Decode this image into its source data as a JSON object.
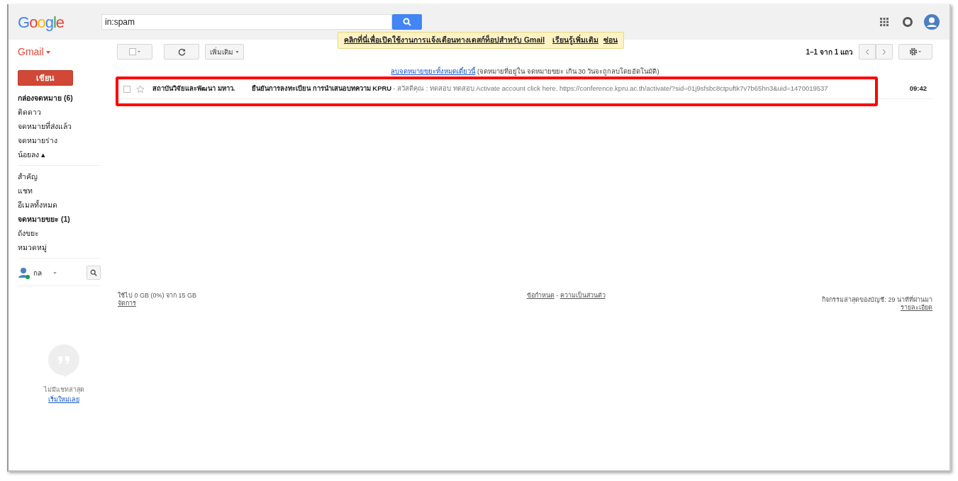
{
  "header": {
    "logo": "Google",
    "search": {
      "value": "in:spam"
    }
  },
  "notification": {
    "text": "คลิกที่นี่เพื่อเปิดใช้งานการแจ้งเตือนทางเดสก์ท็อปสำหรับ Gmail",
    "learn_more": "เรียนรู้เพิ่มเติม",
    "hide": "ซ่อน"
  },
  "app_label": "Gmail",
  "toolbar": {
    "more": "เพิ่มเติม",
    "pagination": "1–1 จาก 1 แถว"
  },
  "compose": "เขียน",
  "sidebar": {
    "primary": [
      {
        "label": "กล่องจดหมาย (6)",
        "bold": true
      },
      {
        "label": "ติดดาว",
        "bold": false
      },
      {
        "label": "จดหมายที่ส่งแล้ว",
        "bold": false
      },
      {
        "label": "จดหมายร่าง",
        "bold": false
      },
      {
        "label": "น้อยลง ▴",
        "bold": false
      }
    ],
    "secondary": [
      {
        "label": "สำคัญ",
        "bold": false
      },
      {
        "label": "แชท",
        "bold": false
      },
      {
        "label": "อีเมลทั้งหมด",
        "bold": false
      },
      {
        "label": "จดหมายขยะ (1)",
        "bold": true
      },
      {
        "label": "ถังขยะ",
        "bold": false
      },
      {
        "label": "หมวดหมู่",
        "bold": false
      }
    ]
  },
  "hangouts": {
    "user": "กล",
    "empty": "ไม่มีแชทล่าสุด",
    "start": "เริ่มใหม่เลย"
  },
  "spam_banner": {
    "link": "ลบจดหมายขยะทั้งหมดเดี๋ยวนี้",
    "note": "(จดหมายที่อยู่ใน จดหมายขยะ เกิน 30 วันจะถูกลบโดยอัตโนมัติ)"
  },
  "messages": [
    {
      "sender": "สถาบันวิจัยและพัฒนา มหาว.",
      "subject": "ยืนยันการลงทะเบียน การนำเสนอบทความ KPRU",
      "snippet": " - สวัสดีคุณ : ทดสอบ ทดสอบ Activate account click here. https://conference.kpru.ac.th/activate/?sid=01j9sfsbc8ctpuftk7v7b65hn3&uid=1470019537",
      "time": "09:42",
      "checked": false,
      "starred": false,
      "highlighted": true
    }
  ],
  "footer": {
    "storage": "ใช้ไป 0 GB (0%) จาก 15 GB",
    "manage": "จัดการ",
    "terms": "ข้อกำหนด",
    "separator": "-",
    "privacy": "ความเป็นส่วนตัว",
    "activity": "กิจกรรมล่าสุดของบัญชี: 29 นาทีที่ผ่านมา",
    "details": "รายละเอียด"
  }
}
